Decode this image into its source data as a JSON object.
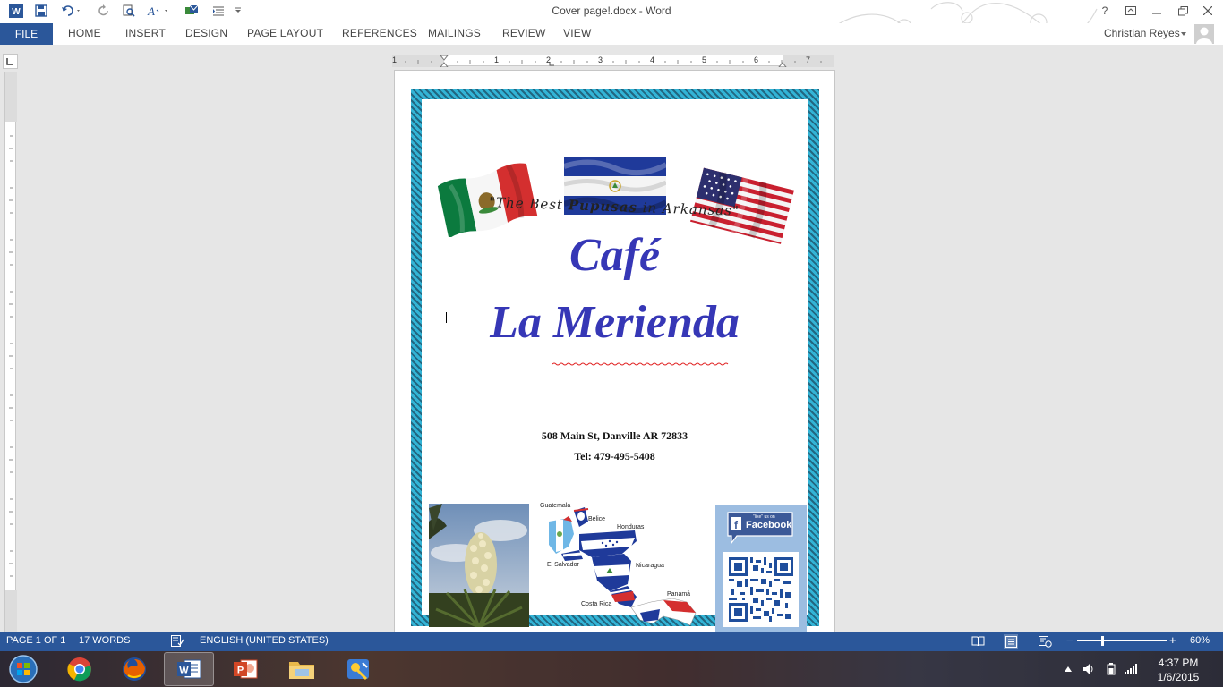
{
  "window": {
    "title": "Cover page!.docx - Word",
    "help": "?",
    "user_name": "Christian Reyes"
  },
  "ribbon": {
    "file_label": "FILE",
    "tabs": [
      "HOME",
      "INSERT",
      "DESIGN",
      "PAGE LAYOUT",
      "REFERENCES",
      "MAILINGS",
      "REVIEW",
      "VIEW"
    ]
  },
  "ruler": {
    "marks": [
      "1",
      "1",
      "2",
      "3",
      "4",
      "5",
      "6",
      "7"
    ]
  },
  "document": {
    "tagline_before": "\"The Best ",
    "tagline_bold": "Pupusas",
    "tagline_after": " in Arkansas\"",
    "title": "Café",
    "name": "La Merienda",
    "address": "508 Main St, Danville AR 72833",
    "phone": "Tel: 479-495-5408",
    "map_labels": {
      "guatemala": "Guatemala",
      "belice": "Belice",
      "honduras": "Honduras",
      "el_salvador": "El Salvador",
      "nicaragua": "Nicaragua",
      "costa_rica": "Costa Rica",
      "panama": "Panamá"
    },
    "facebook_small": "\"like\" us on",
    "facebook_label": "Facebook"
  },
  "status": {
    "page": "PAGE 1 OF 1",
    "words": "17 WORDS",
    "language": "ENGLISH (UNITED STATES)",
    "zoom_minus": "−",
    "zoom_plus": "+",
    "zoom": "60%"
  },
  "taskbar": {
    "time": "4:37 PM",
    "date": "1/6/2015"
  },
  "colors": {
    "word_blue": "#2b579a",
    "title_blue": "#3637b6",
    "border_teal": "#33b4d6"
  }
}
